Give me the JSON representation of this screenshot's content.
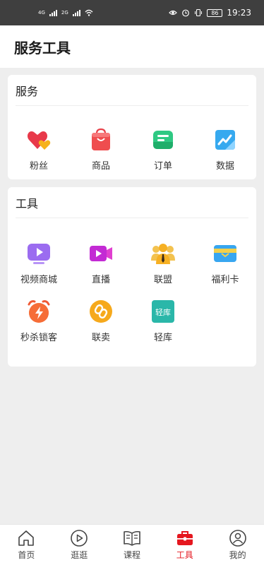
{
  "status_bar": {
    "network_1": "4G",
    "network_2": "2G",
    "battery": "86",
    "time": "19:23"
  },
  "header": {
    "title": "服务工具"
  },
  "services": {
    "title": "服务",
    "items": [
      {
        "label": "粉丝",
        "icon": "fans-heart-icon"
      },
      {
        "label": "商品",
        "icon": "shopping-bag-icon"
      },
      {
        "label": "订单",
        "icon": "order-icon"
      },
      {
        "label": "数据",
        "icon": "data-chart-icon"
      }
    ]
  },
  "tools": {
    "title": "工具",
    "items": [
      {
        "label": "视频商城",
        "icon": "video-mall-icon"
      },
      {
        "label": "直播",
        "icon": "live-camera-icon"
      },
      {
        "label": "联盟",
        "icon": "alliance-people-icon"
      },
      {
        "label": "福利卡",
        "icon": "welfare-card-icon"
      },
      {
        "label": "秒杀锁客",
        "icon": "flash-sale-alarm-icon"
      },
      {
        "label": "联卖",
        "icon": "joint-sale-link-icon"
      },
      {
        "label": "轻库",
        "icon": "light-warehouse-icon",
        "icon_text": "轻库"
      }
    ]
  },
  "bottom_nav": {
    "items": [
      {
        "label": "首页",
        "icon": "home-icon"
      },
      {
        "label": "逛逛",
        "icon": "play-circle-icon"
      },
      {
        "label": "课程",
        "icon": "book-icon"
      },
      {
        "label": "工具",
        "icon": "toolbox-icon",
        "active": true
      },
      {
        "label": "我的",
        "icon": "user-icon"
      }
    ]
  },
  "colors": {
    "active": "#e5171f",
    "status_bar": "#3f3f3f",
    "background": "#eeeeee"
  }
}
